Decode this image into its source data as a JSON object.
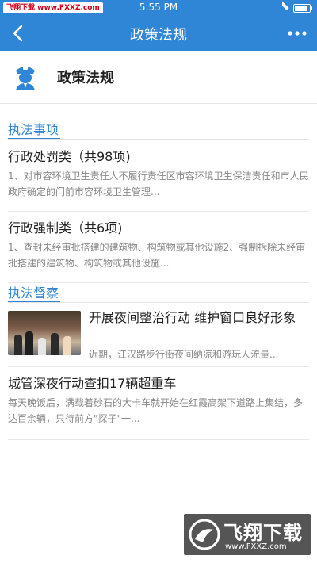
{
  "status_bar": {
    "left_label": "飞翔下载 www.FXXZ.com",
    "time": "5:55 PM",
    "battery_level": 0.95
  },
  "nav": {
    "title": "政策法规"
  },
  "header": {
    "title": "政策法规"
  },
  "sections": [
    {
      "title": "执法事项",
      "items": [
        {
          "title": "行政处罚类（共98项)",
          "desc": "1、对市容环境卫生责任人不履行责任区市容环境卫生保洁责任和市人民政府确定的门前市容环境卫生管理..."
        },
        {
          "title": "行政强制类（共6项)",
          "desc": "1、查封未经审批搭建的建筑物、构筑物或其他设施2、强制拆除未经审批搭建的建筑物、构筑物或其他设施..."
        }
      ]
    },
    {
      "title": "执法督察",
      "news": [
        {
          "title": "开展夜间整治行动 维护窗口良好形象",
          "excerpt": "近期，江汉路步行街夜间纳凉和游玩人流量..."
        },
        {
          "title": "城管深夜行动查扣17辆超重车",
          "excerpt": "每天晚饭后，满载着砂石的大卡车就开始在红霞高架下道路上集结，多达百余辆，只待前方\"探子\"一..."
        }
      ]
    }
  ],
  "watermark": {
    "big": "飞翔下载",
    "small": "www.FXXZ.com"
  },
  "colors": {
    "primary": "#2f86d6"
  }
}
